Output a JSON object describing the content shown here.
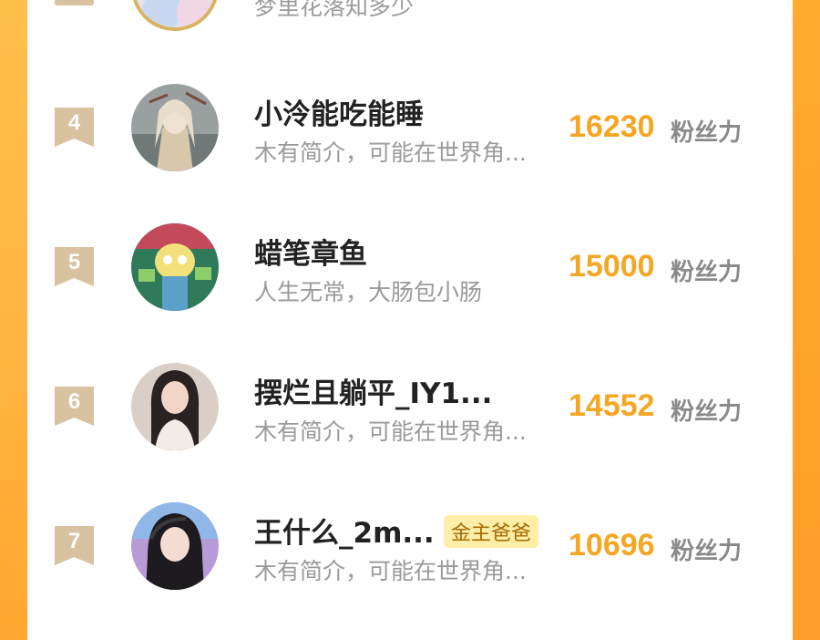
{
  "previous_entry": {
    "bio": "梦里花落知多少"
  },
  "leaderboard": [
    {
      "rank": "4",
      "name": "小泠能吃能睡",
      "badge": "",
      "bio": "木有简介，可能在世界角...",
      "score": "16230",
      "unit": "粉丝力",
      "avatar": "illustrated-girl-avatar"
    },
    {
      "rank": "5",
      "name": "蜡笔章鱼",
      "badge": "",
      "bio": "人生无常，大肠包小肠",
      "score": "15000",
      "unit": "粉丝力",
      "avatar": "cartoon-character-avatar"
    },
    {
      "rank": "6",
      "name": "摆烂且躺平_IY1...",
      "badge": "",
      "bio": "木有简介，可能在世界角...",
      "score": "14552",
      "unit": "粉丝力",
      "avatar": "photo-girl-avatar"
    },
    {
      "rank": "7",
      "name": "王什么_2m...",
      "badge": "金主爸爸",
      "bio": "木有简介，可能在世界角...",
      "score": "10696",
      "unit": "粉丝力",
      "avatar": "photo-girl-headset-avatar"
    }
  ],
  "colors": {
    "score": "#f5a623",
    "rank_ribbon": "#d8c2a0",
    "badge_bg": "#fdeea8"
  }
}
